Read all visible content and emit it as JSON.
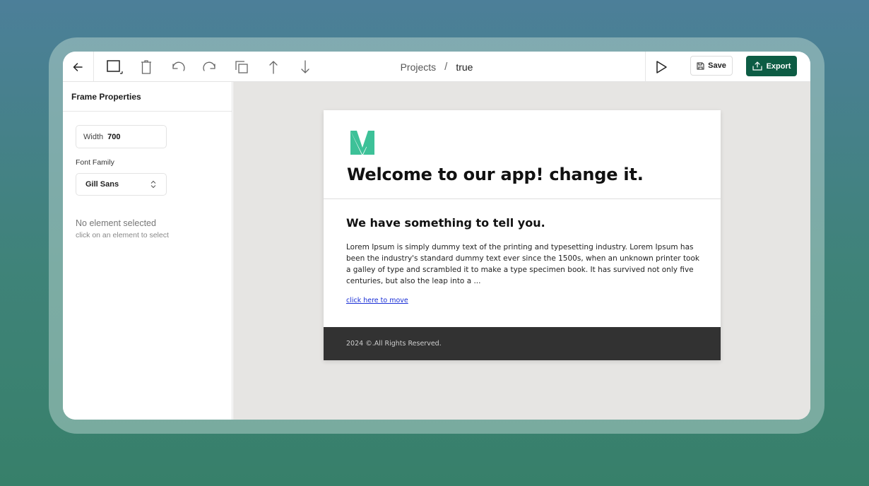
{
  "toolbar": {
    "back_icon": "arrow-left-icon",
    "tools": [
      "frame-icon",
      "trash-icon",
      "undo-icon",
      "redo-icon",
      "duplicate-icon",
      "arrow-up-icon",
      "arrow-down-icon"
    ],
    "play_icon": "play-icon",
    "save_label": "Save",
    "export_label": "Export"
  },
  "breadcrumb": {
    "root": "Projects",
    "separator": "/",
    "current": "true"
  },
  "sidebar": {
    "title": "Frame Properties",
    "width_label": "Width",
    "width_value": "700",
    "font_family_label": "Font Family",
    "font_family_value": "Gill Sans",
    "empty_title": "No element selected",
    "empty_hint": "click on an element to select"
  },
  "email": {
    "logo_color": "#3dc198",
    "title": "Welcome to our app! change it.",
    "subtitle": "We have something to tell you.",
    "body": "Lorem Ipsum is simply dummy text of the printing and typesetting industry. Lorem Ipsum has been the industry's standard dummy text ever since the 1500s, when an unknown printer took a galley of type and scrambled it to make a type specimen book. It has survived not only five centuries, but also the leap into a ...",
    "link": "click here to move",
    "footer": "2024 ©.All Rights Reserved."
  },
  "colors": {
    "accent": "#0d5c44",
    "canvas_bg": "#e6e5e3",
    "footer_bg": "#323232"
  }
}
